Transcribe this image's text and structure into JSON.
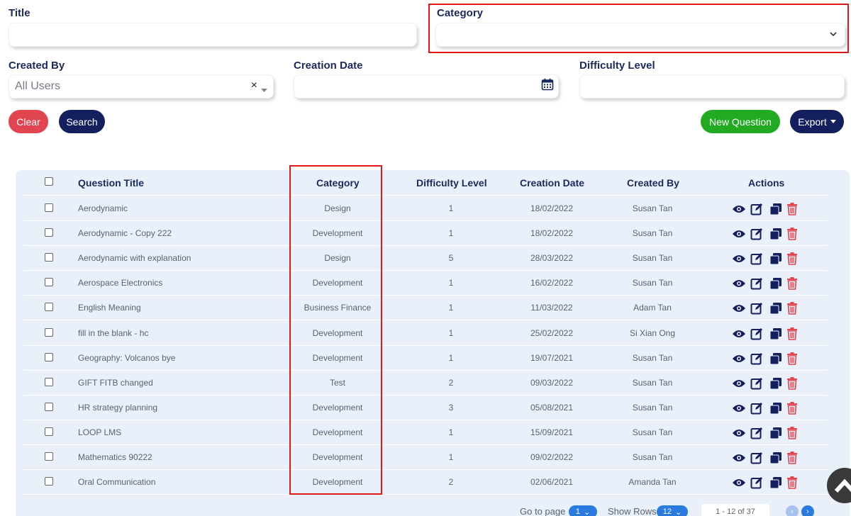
{
  "filters": {
    "title_label": "Title",
    "title_value": "",
    "category_label": "Category",
    "category_value": "",
    "created_by_label": "Created By",
    "created_by_value": "All Users",
    "clear_icon": "×",
    "creation_date_label": "Creation Date",
    "creation_date_value": "",
    "difficulty_label": "Difficulty Level",
    "difficulty_value": ""
  },
  "buttons": {
    "clear": "Clear",
    "search": "Search",
    "new_question": "New Question",
    "export": "Export"
  },
  "table": {
    "headers": {
      "title": "Question Title",
      "category": "Category",
      "difficulty": "Difficulty Level",
      "creation_date": "Creation Date",
      "created_by": "Created By",
      "actions": "Actions"
    },
    "rows": [
      {
        "title": "Aerodynamic",
        "category": "Design",
        "difficulty": "1",
        "date": "18/02/2022",
        "author": "Susan Tan"
      },
      {
        "title": "Aerodynamic - Copy 222",
        "category": "Development",
        "difficulty": "1",
        "date": "18/02/2022",
        "author": "Susan Tan"
      },
      {
        "title": "Aerodynamic with explanation",
        "category": "Design",
        "difficulty": "5",
        "date": "28/03/2022",
        "author": "Susan Tan"
      },
      {
        "title": "Aerospace Electronics",
        "category": "Development",
        "difficulty": "1",
        "date": "16/02/2022",
        "author": "Susan Tan"
      },
      {
        "title": "English Meaning",
        "category": "Business Finance",
        "difficulty": "1",
        "date": "11/03/2022",
        "author": "Adam Tan"
      },
      {
        "title": "fill in the blank - hc",
        "category": "Development",
        "difficulty": "1",
        "date": "25/02/2022",
        "author": "Si Xian Ong"
      },
      {
        "title": "Geography: Volcanos bye",
        "category": "Development",
        "difficulty": "1",
        "date": "19/07/2021",
        "author": "Susan Tan"
      },
      {
        "title": "GIFT FITB changed",
        "category": "Test",
        "difficulty": "2",
        "date": "09/03/2022",
        "author": "Susan Tan"
      },
      {
        "title": "HR strategy planning",
        "category": "Development",
        "difficulty": "3",
        "date": "05/08/2021",
        "author": "Susan Tan"
      },
      {
        "title": "LOOP LMS",
        "category": "Development",
        "difficulty": "1",
        "date": "15/09/2021",
        "author": "Susan Tan"
      },
      {
        "title": "Mathematics 90222",
        "category": "Development",
        "difficulty": "1",
        "date": "09/02/2022",
        "author": "Susan Tan"
      },
      {
        "title": "Oral Communication",
        "category": "Development",
        "difficulty": "2",
        "date": "02/06/2021",
        "author": "Amanda Tan"
      }
    ]
  },
  "pagination": {
    "goto_label": "Go to page",
    "goto_value": "1",
    "show_rows_label": "Show Rows",
    "show_rows_value": "12",
    "range_text": "1 - 12 of 37"
  },
  "colors": {
    "highlight": "#e01818",
    "navy": "#14205e",
    "danger": "#e04550",
    "success": "#22aa22"
  }
}
